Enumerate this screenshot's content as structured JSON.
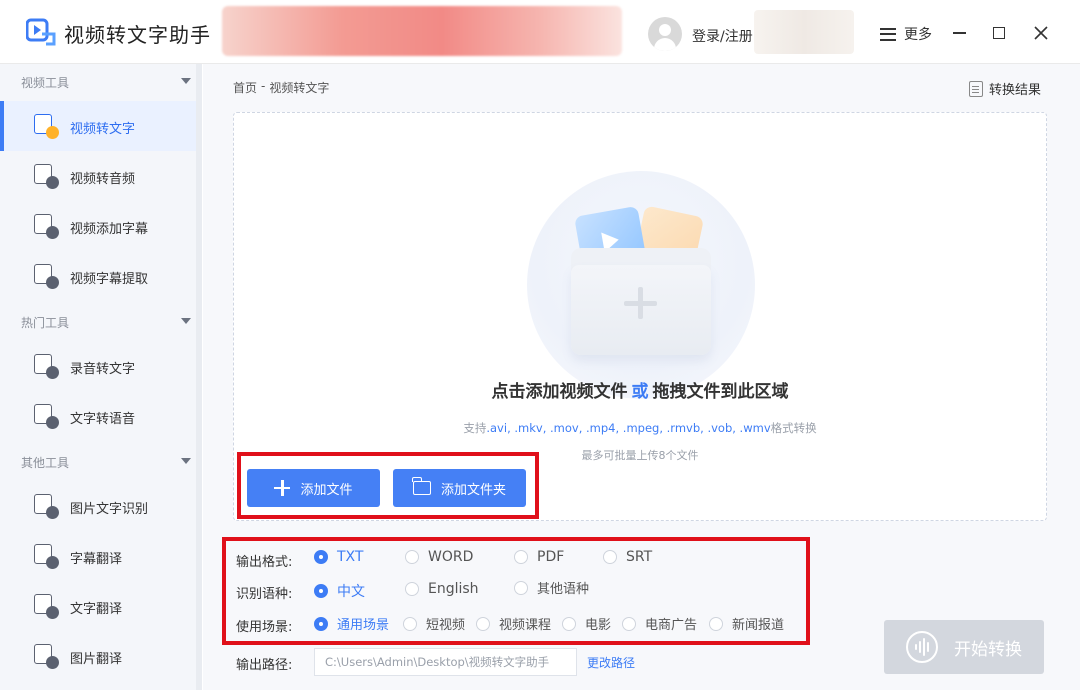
{
  "app": {
    "title": "视频转文字助手",
    "login_label": "登录/注册",
    "more_label": "更多"
  },
  "sidebar": {
    "sections": [
      {
        "title": "视频工具",
        "items": [
          "视频转文字",
          "视频转音频",
          "视频添加字幕",
          "视频字幕提取"
        ]
      },
      {
        "title": "热门工具",
        "items": [
          "录音转文字",
          "文字转语音"
        ]
      },
      {
        "title": "其他工具",
        "items": [
          "图片文字识别",
          "字幕翻译",
          "文字翻译",
          "图片翻译"
        ]
      }
    ],
    "active_item": "视频转文字"
  },
  "breadcrumb": {
    "home": "首页",
    "separator": "-",
    "current": "视频转文字"
  },
  "results_link": "转换结果",
  "dropzone": {
    "headline_part1": "点击添加视频文件",
    "headline_or": "或",
    "headline_part2": "拖拽文件到此区域",
    "support_prefix": "支持",
    "support_formats": ".avi, .mkv, .mov, .mp4, .mpeg, .rmvb, .vob, .wmv",
    "support_suffix": "格式转换",
    "limit_text": "最多可批量上传8个文件"
  },
  "buttons": {
    "add_file": "添加文件",
    "add_folder": "添加文件夹",
    "start": "开始转换"
  },
  "options": {
    "output_format": {
      "label": "输出格式:",
      "choices": [
        "TXT",
        "WORD",
        "PDF",
        "SRT"
      ],
      "selected": "TXT"
    },
    "language": {
      "label": "识别语种:",
      "choices": [
        "中文",
        "English",
        "其他语种"
      ],
      "selected": "中文"
    },
    "scene": {
      "label": "使用场景:",
      "choices": [
        "通用场景",
        "短视频",
        "视频课程",
        "电影",
        "电商广告",
        "新闻报道"
      ],
      "selected": "通用场景"
    }
  },
  "output_path": {
    "label": "输出路径:",
    "value": "C:\\Users\\Admin\\Desktop\\视频转文字助手",
    "change_label": "更改路径"
  },
  "colors": {
    "accent": "#3d7cf5",
    "highlight": "#e0101a",
    "start_disabled": "#d3d7de"
  }
}
